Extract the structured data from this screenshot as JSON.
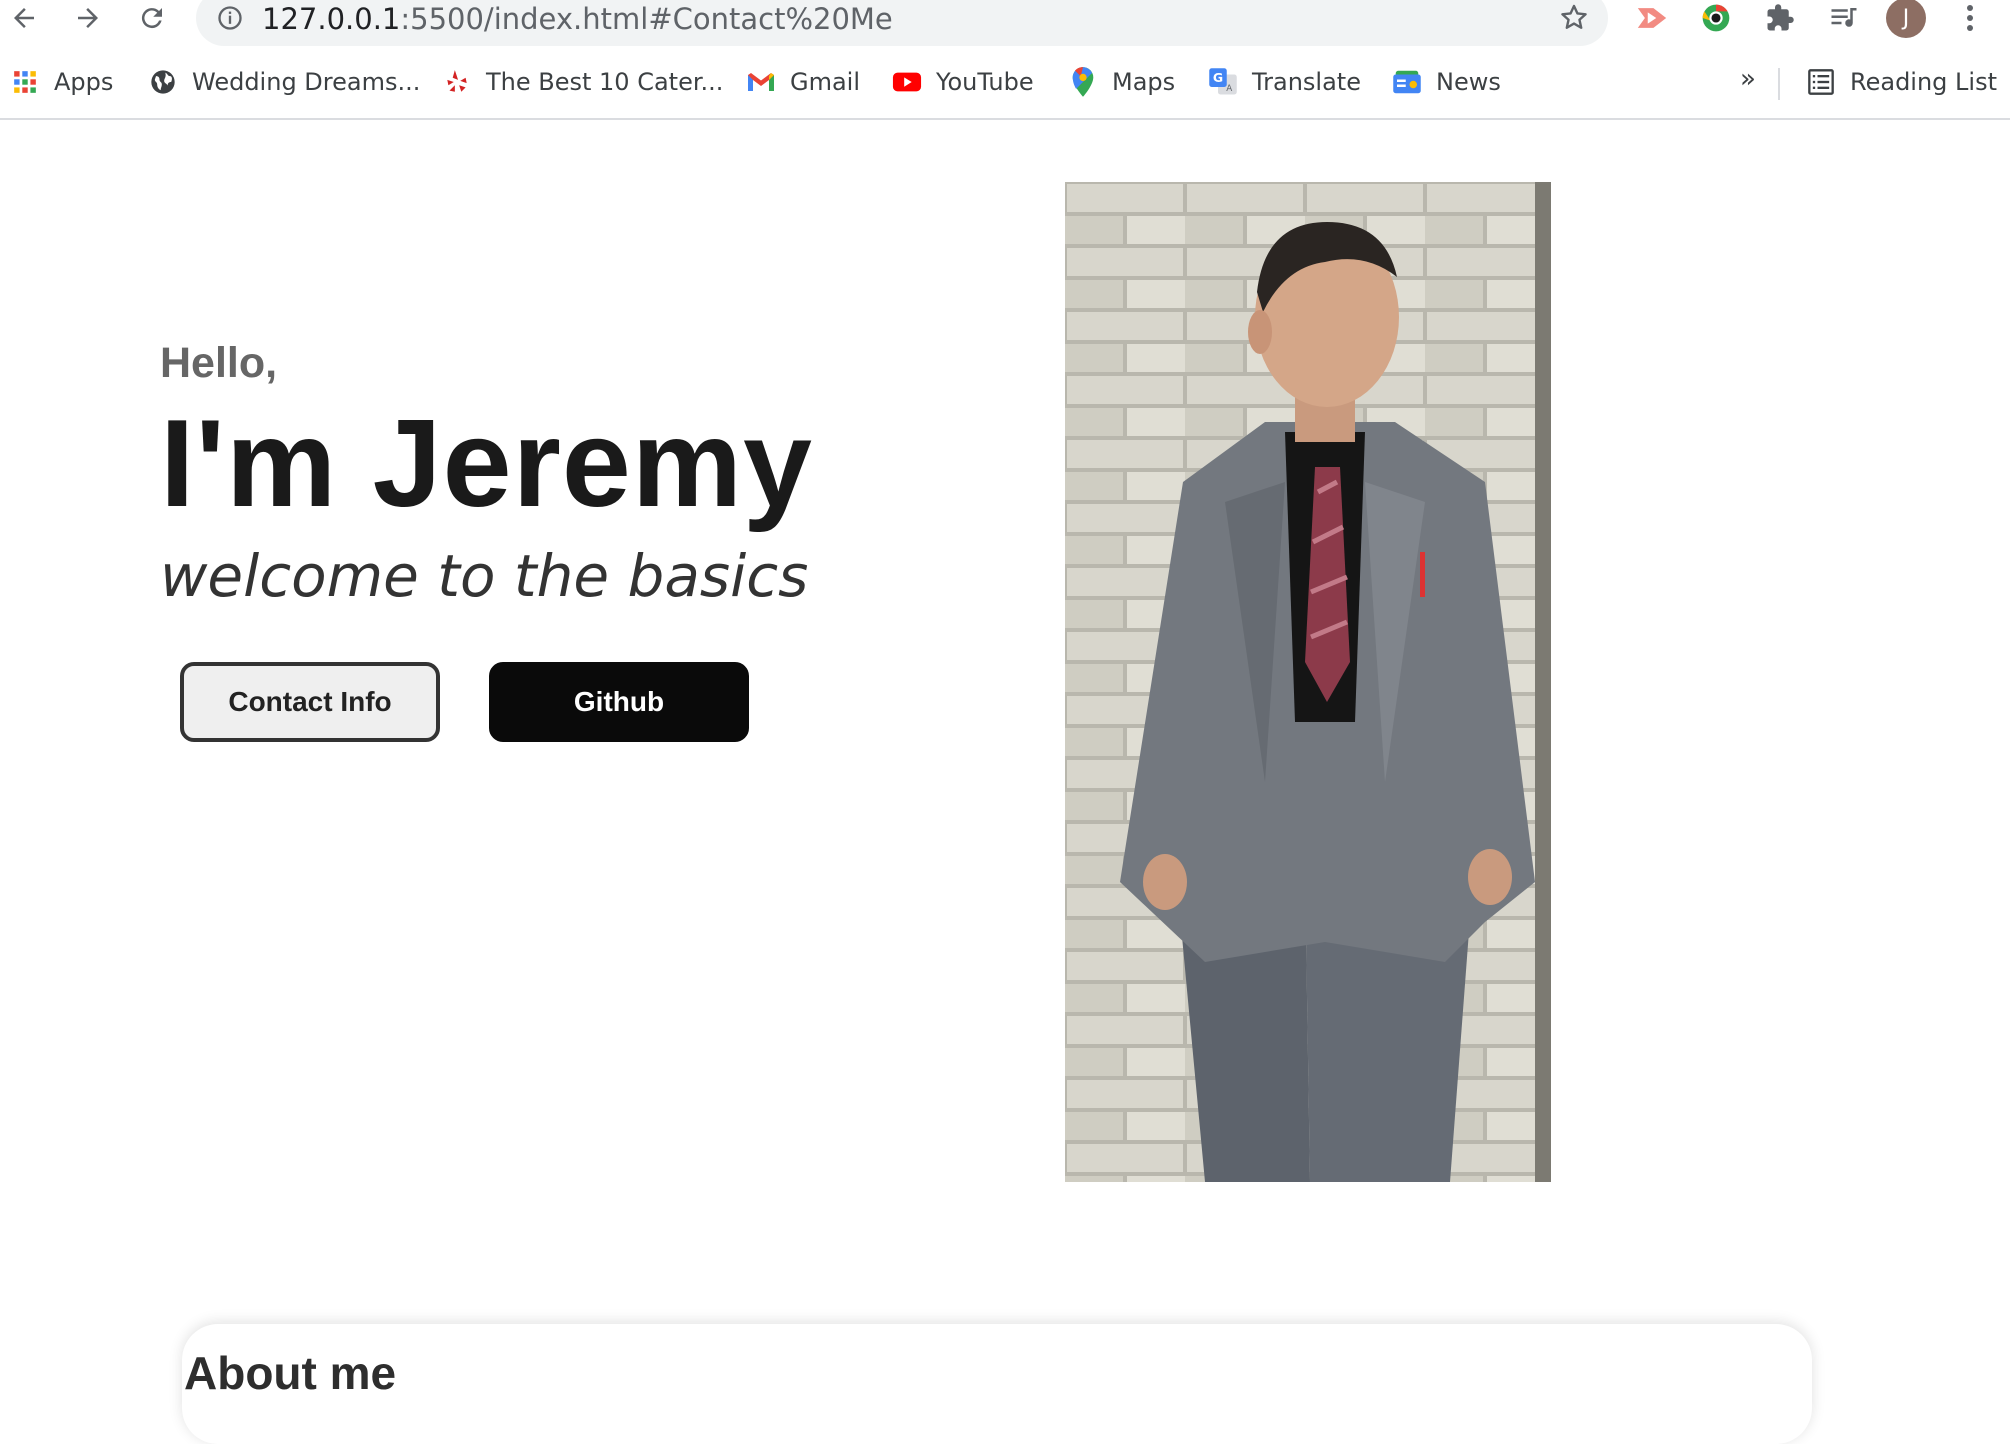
{
  "browser": {
    "url_host": "127.0.0.1",
    "url_rest": ":5500/index.html#Contact%20Me",
    "profile_initial": "J",
    "icons": [
      "back-icon",
      "forward-icon",
      "reload-icon",
      "info-icon",
      "star-icon",
      "cast-icon",
      "chrome-ext-icon",
      "puzzle-icon",
      "media-icon",
      "menu-icon"
    ]
  },
  "bookmarks": {
    "items": [
      {
        "label": "Apps",
        "icon": "apps-grid-icon"
      },
      {
        "label": "Wedding Dreams...",
        "icon": "globe-icon"
      },
      {
        "label": "The Best 10 Cater...",
        "icon": "yelp-icon"
      },
      {
        "label": "Gmail",
        "icon": "gmail-icon"
      },
      {
        "label": "YouTube",
        "icon": "youtube-icon"
      },
      {
        "label": "Maps",
        "icon": "maps-icon"
      },
      {
        "label": "Translate",
        "icon": "translate-icon"
      },
      {
        "label": "News",
        "icon": "news-icon"
      }
    ],
    "more": "»",
    "reading_list": "Reading List"
  },
  "hero": {
    "greeting": "Hello,",
    "name": "I'm Jeremy",
    "tagline": "welcome to the basics",
    "contact_button": "Contact Info",
    "github_button": "Github"
  },
  "about": {
    "title": "About me"
  },
  "colors": {
    "accent_dark": "#0a0a0a",
    "greeting_gray": "#666666"
  }
}
